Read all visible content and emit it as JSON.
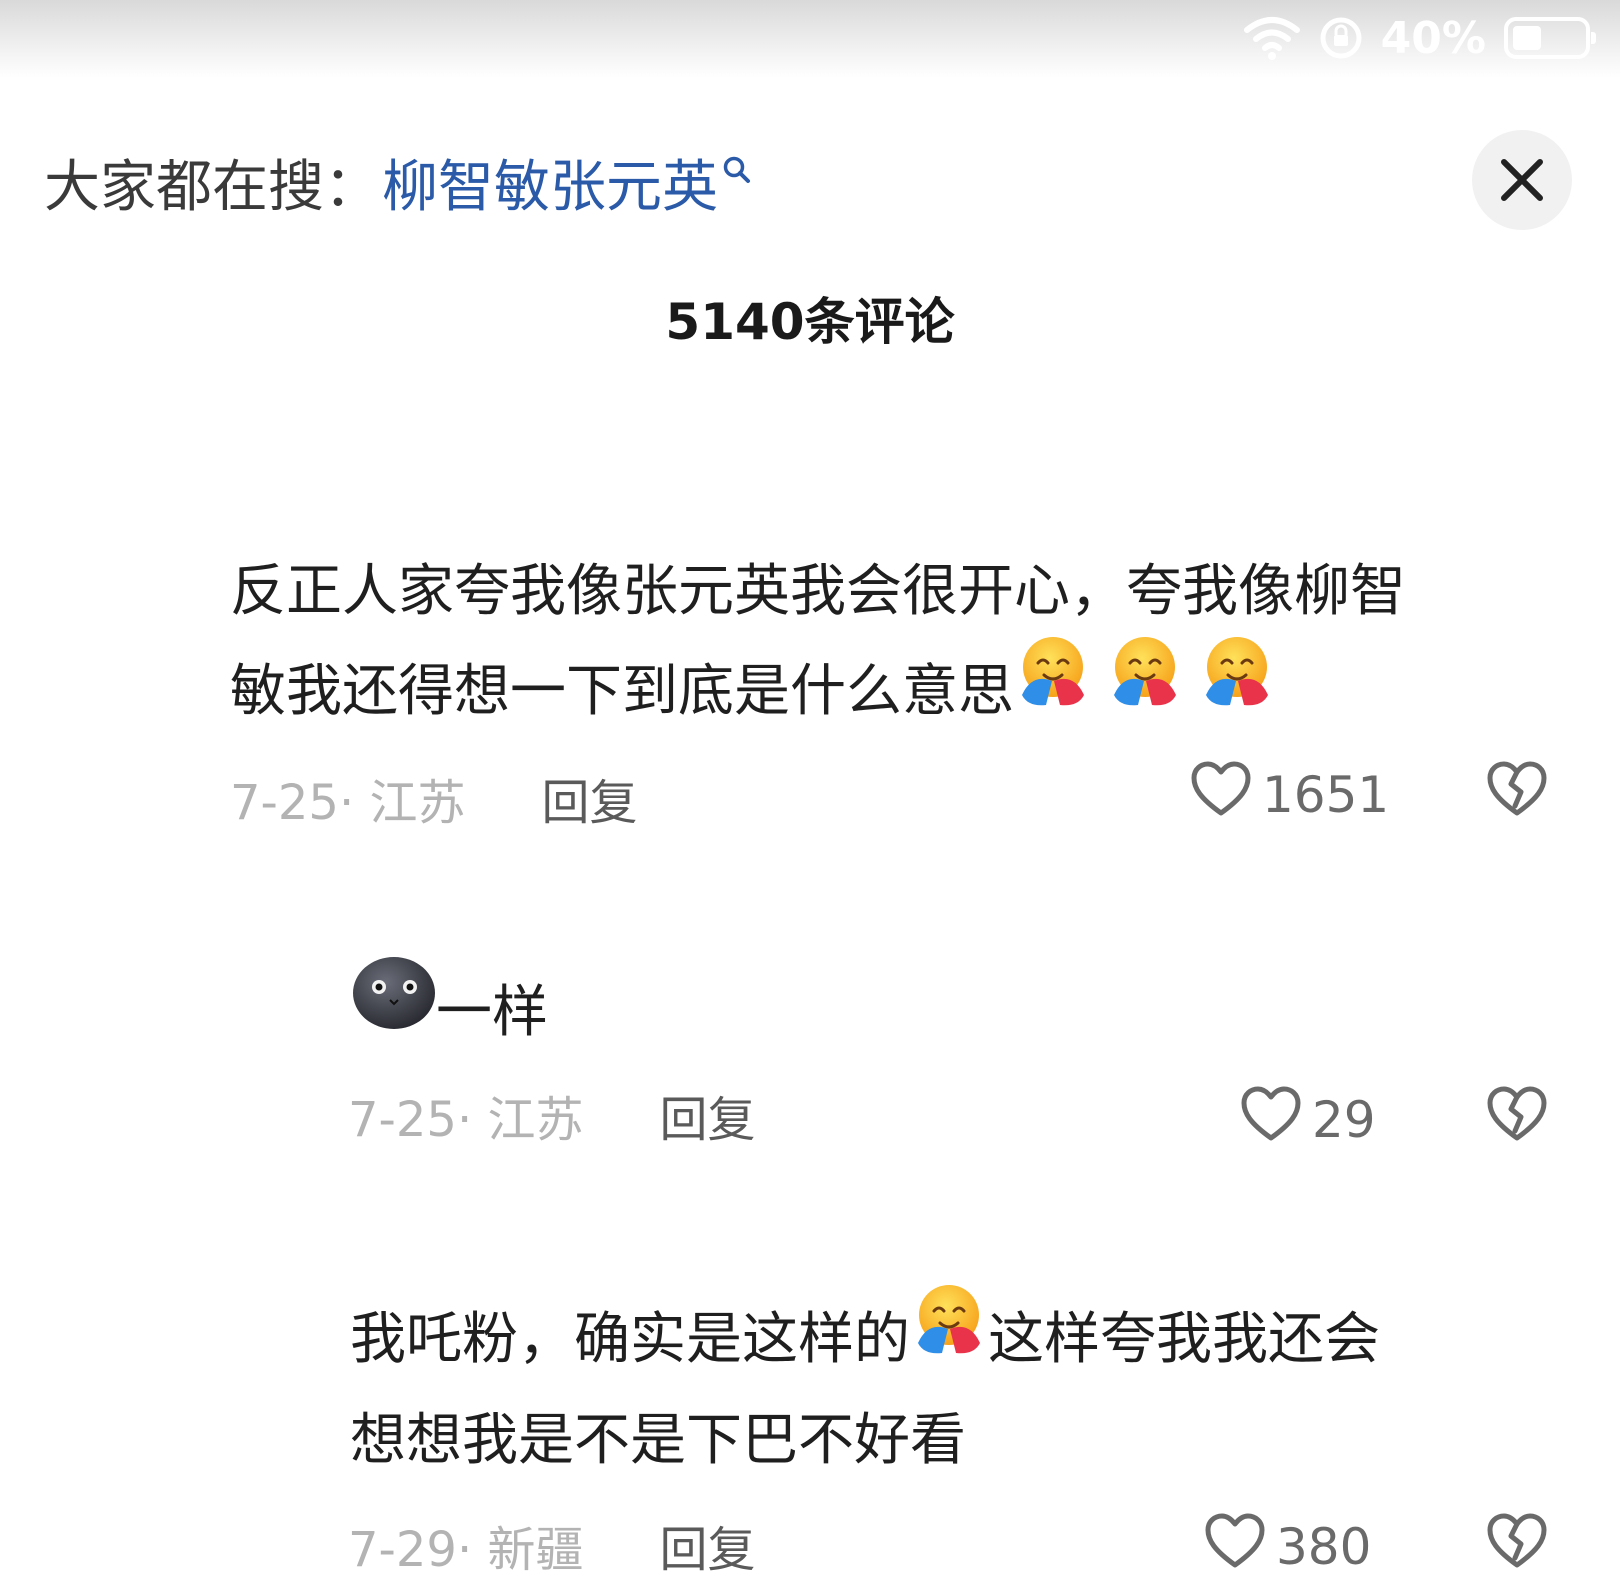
{
  "status_bar": {
    "wifi_icon": "wifi-icon",
    "orientation_icon": "orientation-lock-icon",
    "battery_percent": "40%",
    "battery_level": 0.4
  },
  "search_suggestion": {
    "prefix": "大家都在搜：",
    "query": "柳智敏张元英",
    "icon": "search-icon"
  },
  "header": {
    "comment_count": "5140条评论",
    "close_icon": "close-icon"
  },
  "comments": [
    {
      "line1": "反正人家夸我像张元英我会很开心，夸我像柳智",
      "line2": "敏我还得想一下到底是什么意思",
      "emoji_icon": "hugging-face-emoji",
      "date_location": "7-25· 江苏",
      "reply_label": "回复",
      "like_count": "1651"
    },
    {
      "text": "一样",
      "emoji_icon": "dark-round-face-emoji",
      "date_location": "7-25· 江苏",
      "reply_label": "回复",
      "like_count": "29"
    },
    {
      "line1_a": "我吒粉，确实是这样的",
      "line1_b": "这样夸我我还会",
      "line2": "想想我是不是下巴不好看",
      "emoji_icon": "hugging-face-emoji",
      "date_location": "7-29· 新疆",
      "reply_label": "回复",
      "like_count": "380"
    }
  ],
  "colors": {
    "link_blue": "#2a5aa8",
    "text_primary": "#1f1f1f",
    "meta_gray": "#b3b3b3",
    "close_bg": "#f1f1f1"
  }
}
